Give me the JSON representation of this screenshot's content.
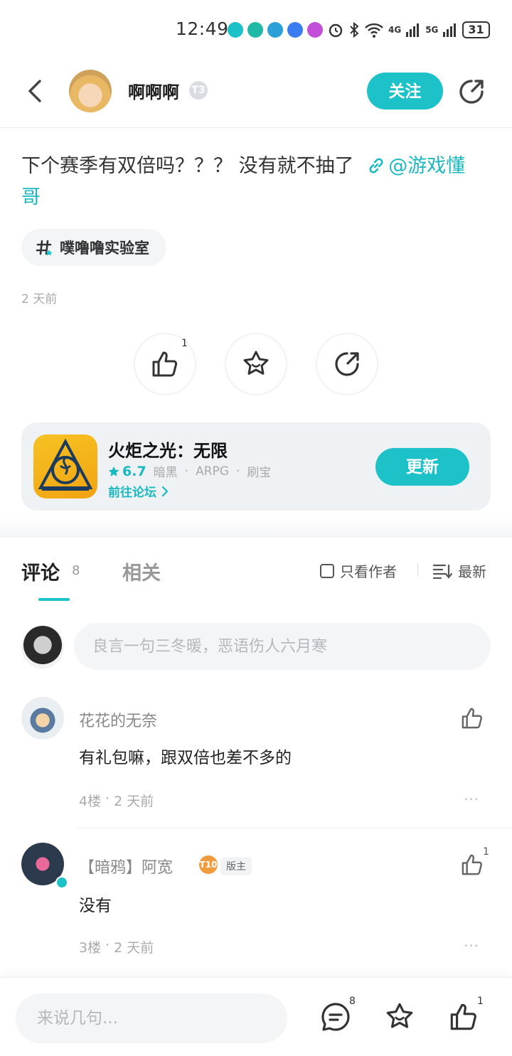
{
  "status_bar": {
    "time": "12:49",
    "network1": "4G",
    "network2": "5G",
    "battery": "31"
  },
  "header": {
    "username": "啊啊啊",
    "level": "T3",
    "follow_label": "关注"
  },
  "post": {
    "text": "下个赛季有双倍吗？？？ 没有就不抽了",
    "mention_line1": "@游戏懂",
    "mention_line2": "哥",
    "topic": "噗噜噜实验室",
    "time": "2 天前",
    "like_count": "1"
  },
  "game_card": {
    "title": "火炬之光：无限",
    "rating": "6.7",
    "tags": [
      "暗黑",
      "ARPG",
      "刷宝"
    ],
    "separator": "·",
    "forum_link": "前往论坛",
    "update_label": "更新"
  },
  "tabs": {
    "comments_label": "评论",
    "comments_count": "8",
    "related_label": "相关",
    "author_only_label": "只看作者",
    "sort_label": "最新"
  },
  "comment_input": {
    "placeholder": "良言一句三冬暖，恶语伤人六月寒"
  },
  "comments": [
    {
      "name": "花花的无奈",
      "text": "有礼包嘛，跟双倍也差不多的",
      "floor": "4楼",
      "time": "2 天前",
      "likes": "",
      "more": "···"
    },
    {
      "name": "【暗鸦】阿宽",
      "level": "T10",
      "role": "版主",
      "text": "没有",
      "floor": "3楼",
      "time": "2 天前",
      "likes": "1",
      "more": "···"
    }
  ],
  "bottom_bar": {
    "placeholder": "来说几句...",
    "comment_count": "8",
    "like_count": "1"
  },
  "colors": {
    "accent": "#1cc2c8",
    "link": "#1cb8c0"
  }
}
